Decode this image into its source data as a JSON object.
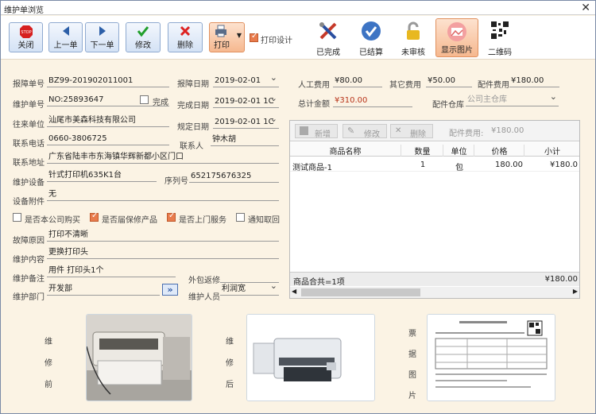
{
  "window": {
    "title": "维护单浏览"
  },
  "toolbar": {
    "close_label": "关闭",
    "prev_label": "上一单",
    "next_label": "下一单",
    "edit_label": "修改",
    "delete_label": "删除",
    "print_label": "打印",
    "print_design_label": "打印设计",
    "completed_label": "已完成",
    "settled_label": "已结算",
    "unreviewed_label": "未审核",
    "show_image_label": "显示图片",
    "qrcode_label": "二维码"
  },
  "form": {
    "report_no": {
      "label": "报障单号",
      "value": "BZ99-201902011001"
    },
    "report_date": {
      "label": "报障日期",
      "value": "2019-02-01"
    },
    "repair_no": {
      "label": "维护单号",
      "value": "NO:25893647"
    },
    "done_label": "完成",
    "done_date": {
      "label": "完成日期",
      "value": "2019-02-01 1C"
    },
    "unit": {
      "label": "往来单位",
      "value": "汕尾市美森科技有限公司"
    },
    "due_date": {
      "label": "规定日期",
      "value": "2019-02-01 1C"
    },
    "phone": {
      "label": "联系电话",
      "value": "0660-3806725"
    },
    "contact": {
      "label": "联系人",
      "value": "钟木胡"
    },
    "address": {
      "label": "联系地址",
      "value": "广东省陆丰市东海镇华辉新都小区门口"
    },
    "device": {
      "label": "维护设备",
      "value": "针式打印机635K1台"
    },
    "serial": {
      "label": "序列号",
      "value": "652175676325"
    },
    "accessory": {
      "label": "设备附件",
      "value": "无"
    },
    "chk_purchased": "是否本公司购买",
    "chk_warranty": "是否届保修产品",
    "chk_onsite": "是否上门服务",
    "chk_notify": "通知取回",
    "fault": {
      "label": "故障原因",
      "value": "打印不清晰"
    },
    "content": {
      "label": "维护内容",
      "value": "更换打印头"
    },
    "remark": {
      "label": "维护备注",
      "value": "用件 打印头1个"
    },
    "outsource_label": "外包返修",
    "dept": {
      "label": "维护部门",
      "value": "开发部"
    },
    "person": {
      "label": "维护人员",
      "value": "利润宽"
    }
  },
  "costs": {
    "labor": {
      "label": "人工费用",
      "value": "¥80.00"
    },
    "other": {
      "label": "其它费用",
      "value": "¥50.00"
    },
    "parts": {
      "label": "配件费用",
      "value": "¥180.00"
    },
    "total": {
      "label": "总计金额",
      "value": "¥310.00"
    },
    "warehouse": {
      "label": "配件仓库",
      "value": "公司主仓库"
    }
  },
  "grid": {
    "add_label": "新增",
    "edit_label": "修改",
    "delete_label": "删除",
    "parts_fee_label": "配件费用:",
    "parts_fee_value": "¥180.00",
    "headers": [
      "商品名称",
      "数量",
      "单位",
      "价格",
      "小计"
    ],
    "rows": [
      [
        "测试商品-1",
        "1",
        "包",
        "180.00",
        "¥180.0"
      ]
    ],
    "summary_label": "商品合共=1项",
    "summary_total": "¥180.00"
  },
  "images": {
    "before_label": [
      "维",
      "修",
      "前"
    ],
    "after_label": [
      "维",
      "修",
      "后"
    ],
    "receipt_label": [
      "票",
      "据",
      "图",
      "片"
    ]
  },
  "colors": {
    "accent": "#e87b4c",
    "toolbar_blue": "#3d74c4"
  }
}
